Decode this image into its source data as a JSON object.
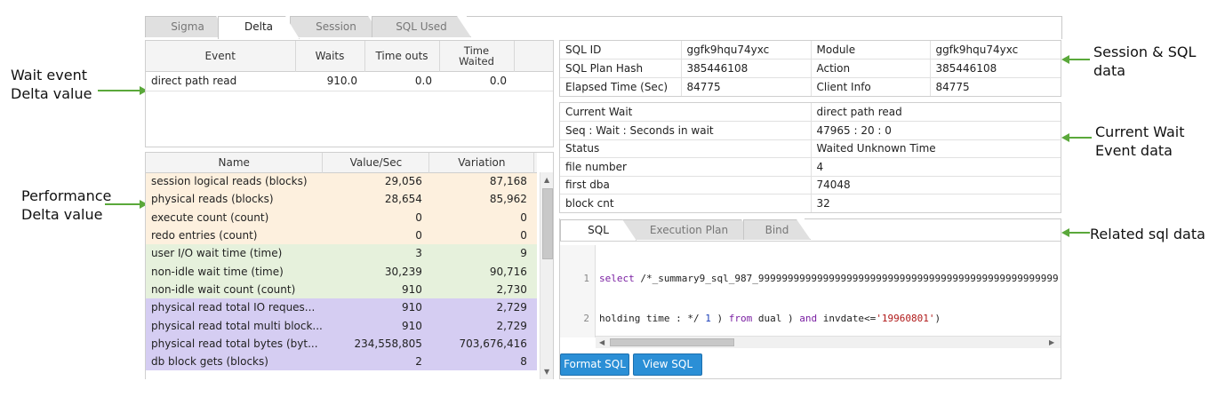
{
  "annotations": {
    "wait_event_l1": "Wait event",
    "wait_event_l2": "Delta value",
    "performance_l1": "Performance",
    "performance_l2": "Delta value",
    "session_sql_l1": "Session & SQL",
    "session_sql_l2": "data",
    "current_wait_l1": "Current Wait",
    "current_wait_l2": "Event data",
    "related_sql": "Related sql data"
  },
  "tabs": [
    {
      "label": "Sigma"
    },
    {
      "label": "Delta"
    },
    {
      "label": "Session"
    },
    {
      "label": "SQL Used"
    }
  ],
  "active_tab": "Delta",
  "wait_table": {
    "headers": [
      "Event",
      "Waits",
      "Time outs",
      "Time Waited"
    ],
    "rows": [
      {
        "event": "direct path read",
        "waits": "910.0",
        "timeouts": "0.0",
        "time_waited": "0.0"
      }
    ]
  },
  "perf_table": {
    "headers": [
      "Name",
      "Value/Sec",
      "Variation"
    ],
    "rows": [
      {
        "name": "session logical reads (blocks)",
        "value": "29,056",
        "variation": "87,168",
        "group": "orange"
      },
      {
        "name": "physical reads (blocks)",
        "value": "28,654",
        "variation": "85,962",
        "group": "orange"
      },
      {
        "name": "execute count (count)",
        "value": "0",
        "variation": "0",
        "group": "orange"
      },
      {
        "name": "redo entries (count)",
        "value": "0",
        "variation": "0",
        "group": "orange"
      },
      {
        "name": "user I/O wait time (time)",
        "value": "3",
        "variation": "9",
        "group": "green"
      },
      {
        "name": "non-idle wait time (time)",
        "value": "30,239",
        "variation": "90,716",
        "group": "green"
      },
      {
        "name": "non-idle wait count (count)",
        "value": "910",
        "variation": "2,730",
        "group": "green"
      },
      {
        "name": "physical read total IO reques...",
        "value": "910",
        "variation": "2,729",
        "group": "purple"
      },
      {
        "name": "physical read total multi block...",
        "value": "910",
        "variation": "2,729",
        "group": "purple"
      },
      {
        "name": "physical read total bytes (byt...",
        "value": "234,558,805",
        "variation": "703,676,416",
        "group": "purple"
      },
      {
        "name": "db block gets (blocks)",
        "value": "2",
        "variation": "8",
        "group": "purple"
      }
    ]
  },
  "session_info": {
    "rows": [
      [
        "SQL ID",
        "ggfk9hqu74yxc",
        "Module",
        "ggfk9hqu74yxc"
      ],
      [
        "SQL Plan Hash",
        "385446108",
        "Action",
        "385446108"
      ],
      [
        "Elapsed Time (Sec)",
        "84775",
        "Client Info",
        "84775"
      ]
    ]
  },
  "current_wait": {
    "rows": [
      [
        "Current Wait",
        "direct path read"
      ],
      [
        "Seq : Wait : Seconds in wait",
        "47965 : 20 : 0"
      ],
      [
        "Status",
        "Waited Unknown Time"
      ],
      [
        "file number",
        "4"
      ],
      [
        "first dba",
        "74048"
      ],
      [
        "block cnt",
        "32"
      ]
    ]
  },
  "sql_tabs": [
    {
      "label": "SQL"
    },
    {
      "label": "Execution Plan"
    },
    {
      "label": "Bind"
    }
  ],
  "sql_editor": {
    "line_numbers": [
      "1",
      "2"
    ],
    "line1_kw": "select",
    "line1_rest": " /*_summary9_sql_987_999999999999999999999999999999999999999999999999999",
    "line2_a": "holding time : */ ",
    "line2_num": "1",
    "line2_b": " ) ",
    "line2_kw1": "from",
    "line2_c": " dual ) ",
    "line2_kw2": "and",
    "line2_d": " invdate<=",
    "line2_str": "'19960801'",
    "line2_e": ")"
  },
  "buttons": {
    "format_sql": "Format SQL",
    "view_sql": "View SQL"
  },
  "colors": {
    "accent_button": "#2b8fd6",
    "annotation_arrow": "#5aa83a",
    "row_orange": "#fdf0de",
    "row_green": "#e6f1dc",
    "row_purple": "#d5cdf2"
  }
}
